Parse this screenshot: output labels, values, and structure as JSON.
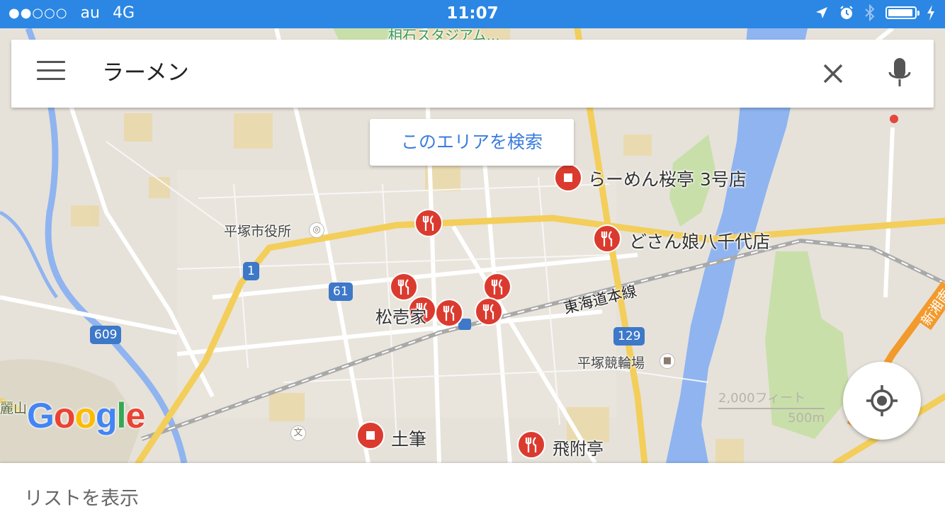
{
  "status_bar": {
    "signal_dots": "●●○○○",
    "carrier": "au",
    "network": "4G",
    "time": "11:07",
    "battery_level": 0.95,
    "icons": [
      "location-arrow-icon",
      "alarm-icon",
      "bluetooth-icon",
      "battery-icon",
      "charging-icon"
    ]
  },
  "search": {
    "query": "ラーメン",
    "menu_icon": "hamburger-menu-icon",
    "clear_icon": "close-icon",
    "mic_icon": "microphone-icon"
  },
  "search_area_button": "このエリアを検索",
  "map": {
    "top_partial_label": "相石スタジアム...",
    "results": [
      {
        "name": "らーめん桜亭 3号店",
        "icon": "square-pin-icon"
      },
      {
        "name": "どさん娘八千代店",
        "icon": "restaurant-pin-icon"
      },
      {
        "name": "松壱家",
        "icon": "restaurant-pin-icon"
      },
      {
        "name": "土筆",
        "icon": "square-pin-icon"
      },
      {
        "name": "飛附亭",
        "icon": "restaurant-pin-icon"
      }
    ],
    "places": {
      "city_hall": "平塚市役所",
      "velodrome": "平塚競輪場",
      "railway": "東海道本線",
      "mountain_partial": "麗山",
      "highway_partial": "新湘南",
      "school_glyph": "文"
    },
    "routes": [
      "1",
      "61",
      "609",
      "129"
    ],
    "scale": {
      "top": "2,000フィート",
      "bottom": "500m"
    }
  },
  "brand": {
    "logo": "Google",
    "colors": [
      "#4285f4",
      "#ea4335",
      "#fbbc05",
      "#4285f4",
      "#34a853",
      "#ea4335"
    ]
  },
  "locate_icon": "my-location-icon",
  "bottom_sheet": {
    "label": "リストを表示"
  },
  "colors": {
    "status_bar": "#2b87e3",
    "pin_red": "#db3b2f",
    "accent_blue": "#3b7cde",
    "water": "#8fb4f0",
    "road_yellow": "#f3ce5a"
  }
}
